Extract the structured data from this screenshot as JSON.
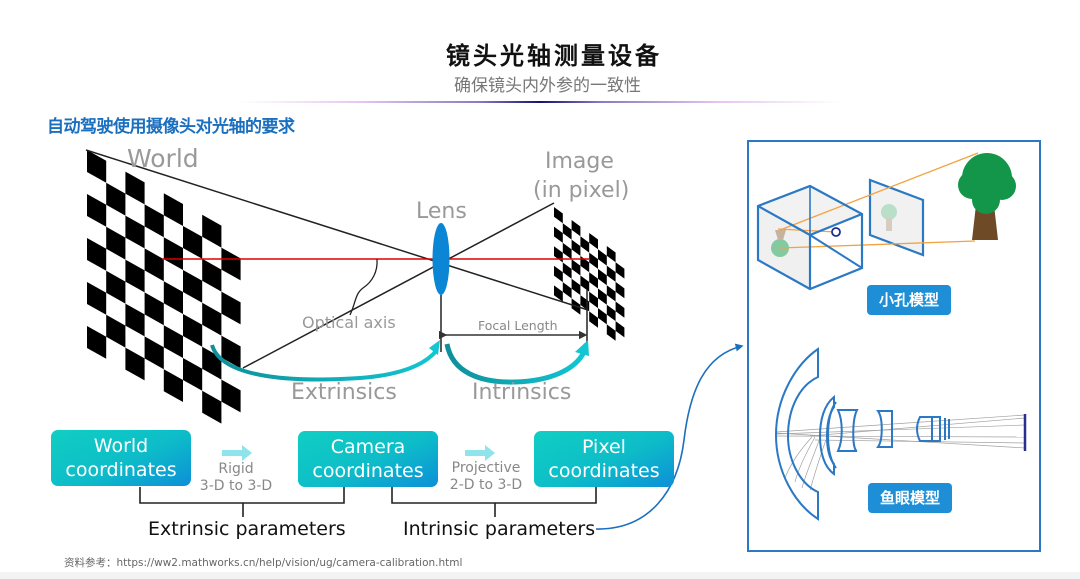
{
  "header": {
    "title": "镜头光轴测量设备",
    "subtitle": "确保镜头内外参的一致性"
  },
  "section_heading": "自动驾驶使用摄像头对光轴的要求",
  "diagram": {
    "labels": {
      "world": "World",
      "lens": "Lens",
      "image_line1": "Image",
      "image_line2": "(in pixel)",
      "optical_axis": "Optical axis",
      "focal_length": "Focal Length",
      "extrinsics": "Extrinsics",
      "intrinsics": "Intrinsics"
    },
    "colors": {
      "optical_axis": "#e00000",
      "lens": "#0a86d4",
      "arrow": "#10b8c8",
      "box_start": "#10cfc3",
      "box_end": "#0d8fd8",
      "panel_border": "#2b78c4",
      "tag": "#1e8fd6"
    }
  },
  "pipeline": {
    "boxes": [
      {
        "line1": "World",
        "line2": "coordinates"
      },
      {
        "line1": "Camera",
        "line2": "coordinates"
      },
      {
        "line1": "Pixel",
        "line2": "coordinates"
      }
    ],
    "transforms": [
      {
        "line1": "Rigid",
        "line2": "3-D to 3-D"
      },
      {
        "line1": "Projective",
        "line2": "2-D to 3-D"
      }
    ],
    "parameters": {
      "extrinsic": "Extrinsic parameters",
      "intrinsic": "Intrinsic parameters"
    }
  },
  "models_panel": {
    "pinhole_label": "小孔模型",
    "fisheye_label": "鱼眼模型"
  },
  "reference": "资料参考：https://ww2.mathworks.cn/help/vision/ug/camera-calibration.html"
}
